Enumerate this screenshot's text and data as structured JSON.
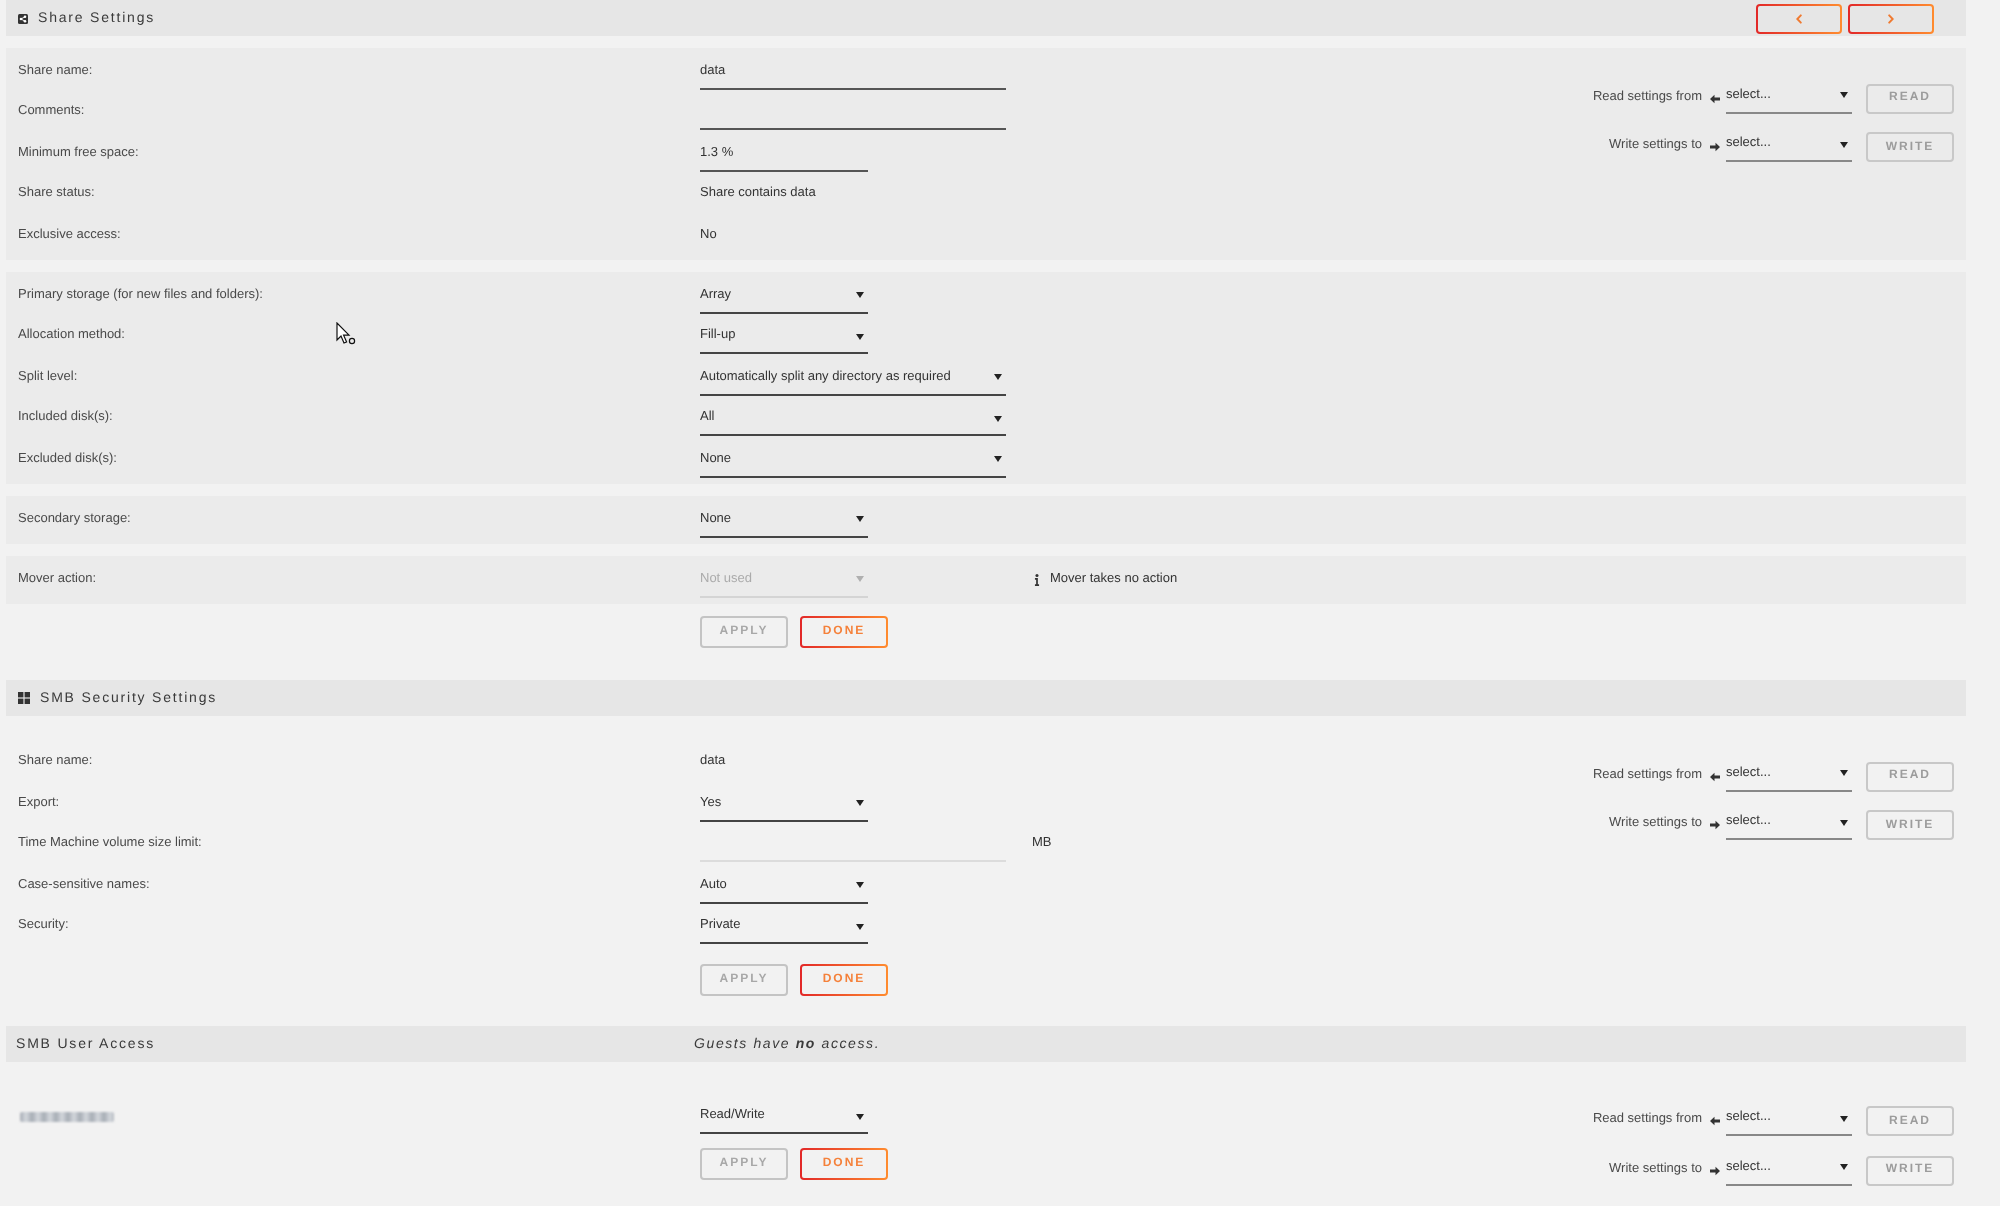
{
  "sections": [
    {
      "kind": "share",
      "title": "Share Settings",
      "groups": [
        {
          "rows": [
            {
              "label": "Share name:",
              "kind": "input",
              "value": "data",
              "disabled": false
            },
            {
              "label": "Comments:",
              "kind": "input",
              "disabled": false
            },
            {
              "label": "Minimum free space:",
              "kind": "input",
              "value": "1.3 %",
              "disabled": false
            },
            {
              "label": "Share status:",
              "kind": "text",
              "value": "Share contains data"
            },
            {
              "label": "Exclusive access:",
              "kind": "text",
              "value": "No"
            }
          ]
        },
        {
          "rows": [
            {
              "label": "Primary storage (for new files and folders):",
              "kind": "select",
              "value": "Array",
              "disabled": false
            },
            {
              "label": "Allocation method:",
              "kind": "select",
              "value": "Fill-up",
              "disabled": false
            },
            {
              "label": "Split level:",
              "kind": "select",
              "value": "Automatically split any directory as required",
              "disabled": false
            },
            {
              "label": "Included disk(s):",
              "kind": "select",
              "value": "All",
              "disabled": false
            },
            {
              "label": "Excluded disk(s):",
              "kind": "select",
              "value": "None",
              "disabled": false
            }
          ]
        },
        {
          "rows": [
            {
              "label": "Secondary storage:",
              "kind": "select",
              "value": "None",
              "disabled": false
            }
          ]
        },
        {
          "rows": [
            {
              "label": "Mover action:",
              "kind": "select",
              "value": "Not used",
              "disabled": true,
              "note": "Mover takes no action"
            }
          ]
        }
      ],
      "transfer": [
        {
          "kind": "read",
          "label": "Read settings from",
          "value": "select...",
          "button": "READ",
          "disabled": true
        },
        {
          "kind": "write",
          "label": "Write settings to",
          "value": "select...",
          "button": "WRITE",
          "disabled": true
        }
      ],
      "actions": [
        {
          "label": "APPLY",
          "disabled": true
        },
        {
          "label": "DONE",
          "disabled": false
        }
      ]
    },
    {
      "kind": "smb_security",
      "title": "SMB Security Settings",
      "groups": [
        {
          "rows": [
            {
              "label": "Share name:",
              "kind": "text",
              "value": "data"
            },
            {
              "label": "Export:",
              "kind": "select",
              "value": "Yes",
              "disabled": false
            },
            {
              "label": "Time Machine volume size limit:",
              "kind": "input",
              "disabled": true,
              "unit": "MB"
            },
            {
              "label": "Case-sensitive names:",
              "kind": "select",
              "value": "Auto",
              "disabled": false
            },
            {
              "label": "Security:",
              "kind": "select",
              "value": "Private",
              "disabled": false
            }
          ]
        }
      ],
      "transfer": [
        {
          "kind": "read",
          "label": "Read settings from",
          "value": "select...",
          "button": "READ",
          "disabled": true
        },
        {
          "kind": "write",
          "label": "Write settings to",
          "value": "select...",
          "button": "WRITE",
          "disabled": true
        }
      ],
      "actions": [
        {
          "label": "APPLY",
          "disabled": true
        },
        {
          "label": "DONE",
          "disabled": false
        }
      ]
    },
    {
      "kind": "smb_user_access",
      "title": "SMB User Access",
      "note": "Guests have **no** access.",
      "groups": [
        {
          "rows": [
            {
              "kind": "user",
              "value": "Read/Write",
              "disabled": false
            }
          ]
        }
      ],
      "transfer": [
        {
          "kind": "read",
          "label": "Read settings from",
          "value": "select...",
          "button": "READ",
          "disabled": true
        },
        {
          "kind": "write",
          "label": "Write settings to",
          "value": "select...",
          "button": "WRITE",
          "disabled": true
        }
      ],
      "actions": [
        {
          "label": "APPLY",
          "disabled": true
        },
        {
          "label": "DONE",
          "disabled": false
        }
      ]
    }
  ]
}
